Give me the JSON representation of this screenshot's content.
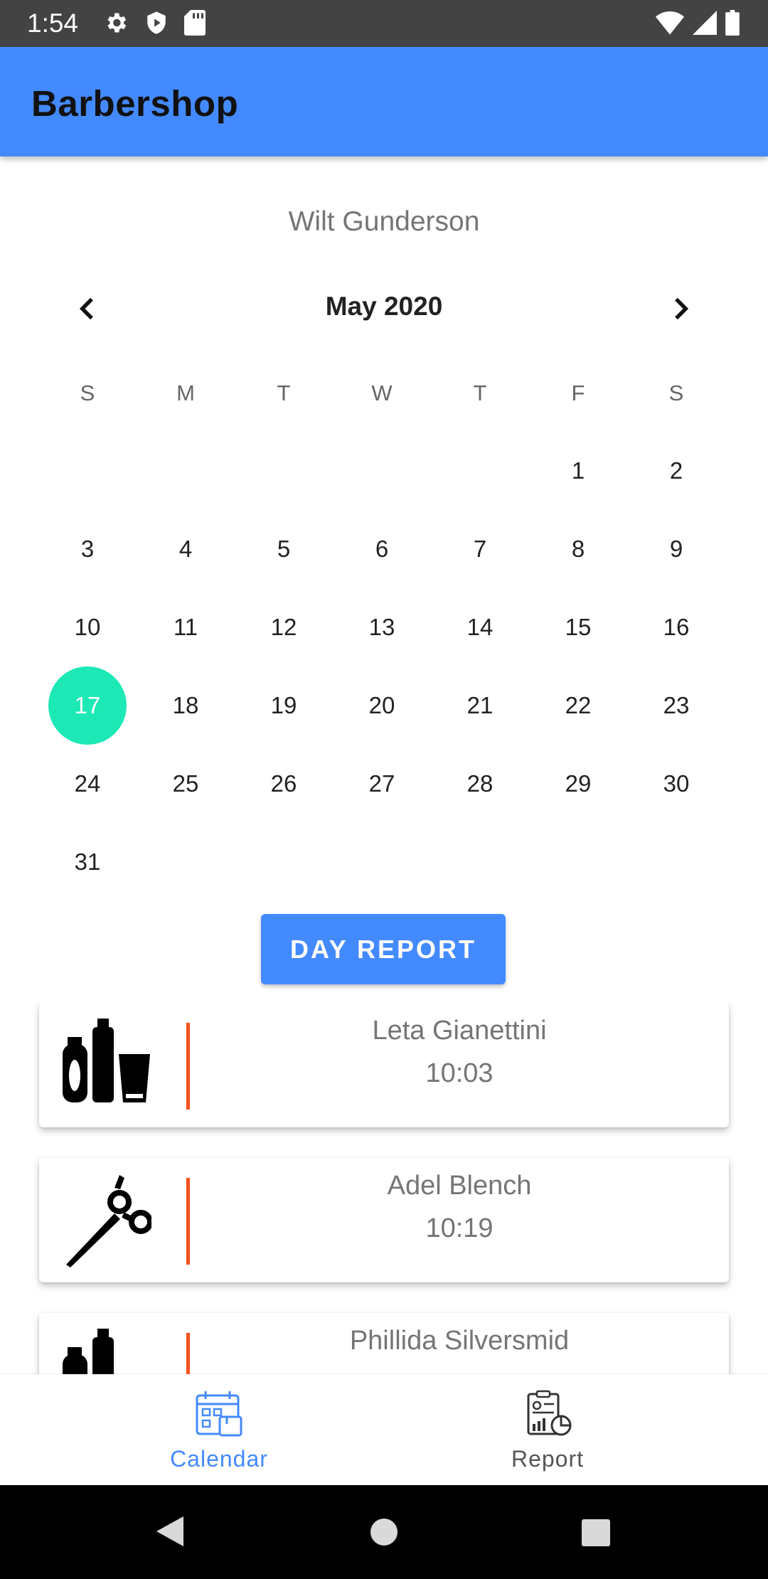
{
  "status_bar": {
    "time": "1:54",
    "icons_left": [
      "settings-icon",
      "shield-icon",
      "sd-card-icon"
    ],
    "icons_right": [
      "wifi-icon",
      "signal-icon",
      "battery-icon"
    ]
  },
  "app_bar": {
    "title": "Barbershop",
    "color": "#448aff"
  },
  "barber_name": "Wilt Gunderson",
  "calendar": {
    "month_label": "May 2020",
    "weekdays": [
      "S",
      "M",
      "T",
      "W",
      "T",
      "F",
      "S"
    ],
    "selected_day": 17,
    "selected_color": "#1de9b6",
    "weeks": [
      [
        "",
        "",
        "",
        "",
        "",
        "1",
        "2"
      ],
      [
        "3",
        "4",
        "5",
        "6",
        "7",
        "8",
        "9"
      ],
      [
        "10",
        "11",
        "12",
        "13",
        "14",
        "15",
        "16"
      ],
      [
        "17",
        "18",
        "19",
        "20",
        "21",
        "22",
        "23"
      ],
      [
        "24",
        "25",
        "26",
        "27",
        "28",
        "29",
        "30"
      ],
      [
        "31",
        "",
        "",
        "",
        "",
        "",
        ""
      ]
    ]
  },
  "day_report_button": "DAY REPORT",
  "appointments": [
    {
      "client": "Leta Gianettini",
      "time": "10:03",
      "icon": "hair-products-icon"
    },
    {
      "client": "Adel Blench",
      "time": "10:19",
      "icon": "scissors-icon"
    },
    {
      "client": "Phillida Silversmid",
      "time": "",
      "icon": "hair-products-icon"
    }
  ],
  "accent_divider_color": "#f4511e",
  "bottom_nav": {
    "items": [
      {
        "label": "Calendar",
        "icon": "calendar-icon",
        "active": true
      },
      {
        "label": "Report",
        "icon": "report-icon",
        "active": false
      }
    ]
  },
  "system_nav": [
    "back-icon",
    "home-icon",
    "recents-icon"
  ]
}
